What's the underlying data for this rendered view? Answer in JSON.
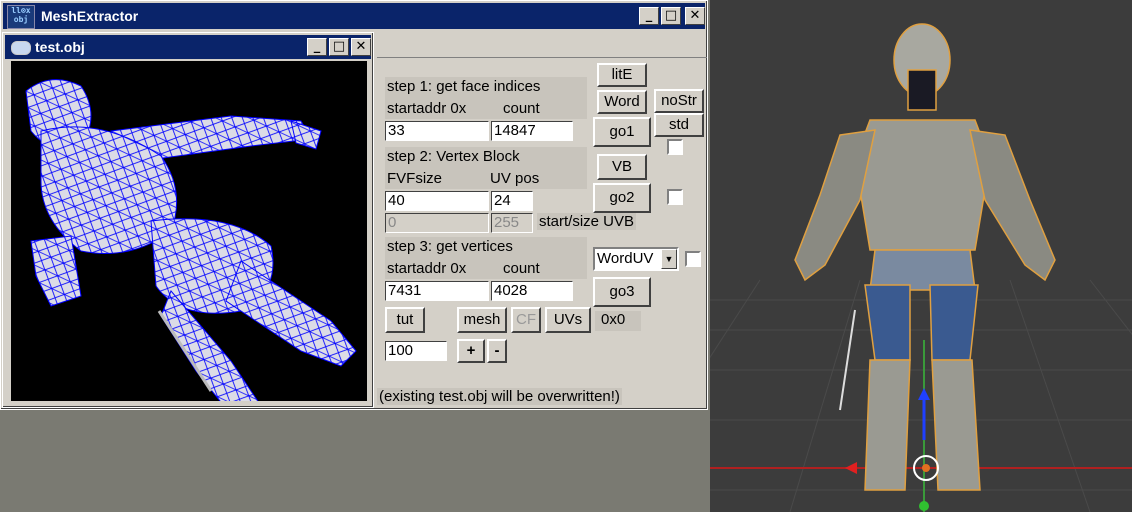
{
  "main_window": {
    "title": "MeshExtractor",
    "icon_text": "ll⊗x obj",
    "min_label": "_",
    "max_label": "□",
    "close_label": "✕"
  },
  "child_window": {
    "title": "test.obj",
    "min_label": "_",
    "max_label": "□",
    "close_label": "✕"
  },
  "step1": {
    "heading": "step 1: get face indices",
    "startaddr_label": "startaddr 0x",
    "count_label": "count",
    "startaddr_value": "33",
    "count_value": "14847",
    "go_label": "go1"
  },
  "step2": {
    "heading": "step 2: Vertex Block",
    "fvf_label": "FVFsize",
    "uvpos_label": "UV pos",
    "fvf_value": "40",
    "uvpos_value": "24",
    "uvb_start_value": "0",
    "uvb_size_value": "255",
    "uvb_label": "start/size UVB",
    "vb_label": "VB",
    "go_label": "go2"
  },
  "step3": {
    "heading": "step 3: get vertices",
    "startaddr_label": "startaddr 0x",
    "count_label": "count",
    "startaddr_value": "7431",
    "count_value": "4028",
    "go_label": "go3",
    "uv_mode_selected": "WordUV"
  },
  "format_buttons": {
    "lite": "litE",
    "word": "Word",
    "nostr": "noStr",
    "std": "std"
  },
  "bottom": {
    "tut": "tut",
    "mesh": "mesh",
    "cf": "CF",
    "uvs": "UVs",
    "hex_readout": "0x0",
    "scale_value": "100",
    "plus": "+",
    "minus": "-",
    "warning": "(existing test.obj will be overwritten!)"
  },
  "colors": {
    "wire": "#0000ff",
    "title_bar": "#0a246a",
    "face": "#d8d8e8"
  }
}
